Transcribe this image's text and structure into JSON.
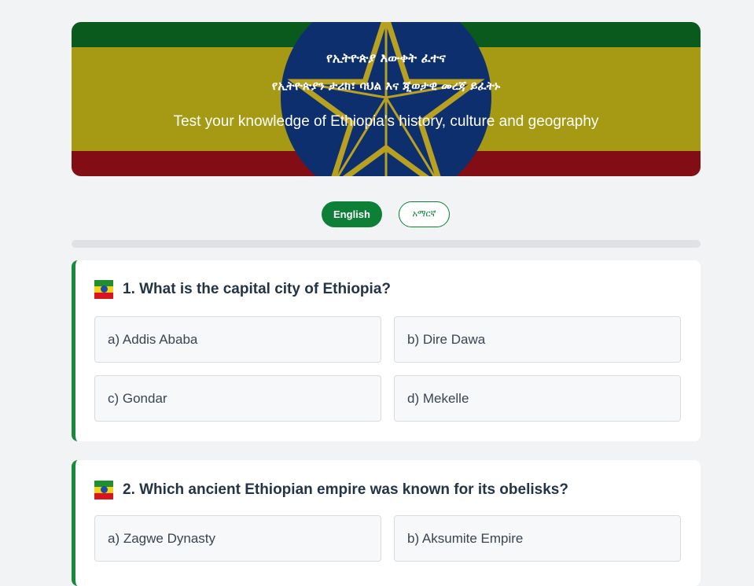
{
  "header": {
    "title_am": "የኢትዮጵያ እውቀት ፈተና",
    "subtitle_am": "የኢትዮጵያን ታሪክ፣ ባህል እና ጂወታዊ መረጃ ይፈትኑ",
    "subtitle_en": "Test your knowledge of Ethiopia's history, culture and geography",
    "emblem_icon": "ethiopian-star-emblem-icon",
    "colors": {
      "green": "#0a5a1e",
      "yellow": "#a69a14",
      "red": "#8a0e17",
      "blue": "#0e2f6e"
    }
  },
  "language": {
    "english_label": "English",
    "amharic_label": "አማርኛ",
    "selected": "English",
    "accent": "#0d7f36"
  },
  "progress": {
    "value": 0
  },
  "questions": [
    {
      "text": "1. What is the capital city of Ethiopia?",
      "icon": "ethiopia-flag-icon",
      "options": [
        "a) Addis Ababa",
        "b) Dire Dawa",
        "c) Gondar",
        "d) Mekelle"
      ]
    },
    {
      "text": "2. Which ancient Ethiopian empire was known for its obelisks?",
      "icon": "ethiopia-flag-icon",
      "options": [
        "a) Zagwe Dynasty",
        "b) Aksumite Empire"
      ]
    }
  ]
}
